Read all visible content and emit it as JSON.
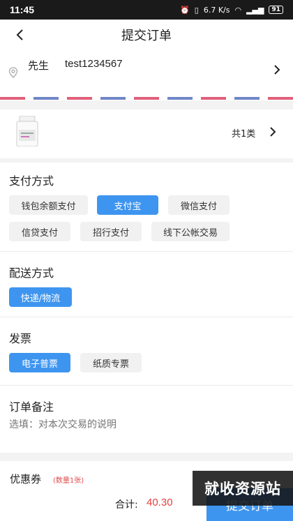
{
  "status": {
    "time": "11:45",
    "net_speed": "6.7 K/s",
    "battery": "91"
  },
  "nav": {
    "title": "提交订单"
  },
  "address": {
    "name": "先生",
    "phone": "test1234567"
  },
  "product": {
    "count_text": "共1类"
  },
  "payment": {
    "title": "支付方式",
    "options": [
      "钱包余额支付",
      "支付宝",
      "微信支付",
      "信贷支付",
      "招行支付",
      "线下公帐交易"
    ],
    "selected": "支付宝"
  },
  "delivery": {
    "title": "配送方式",
    "options": [
      "快递/物流"
    ],
    "selected": "快递/物流"
  },
  "invoice": {
    "title": "发票",
    "options": [
      "电子普票",
      "纸质专票"
    ],
    "selected": "电子普票"
  },
  "remark": {
    "title": "订单备注",
    "placeholder": "选填：对本次交易的说明"
  },
  "coupon": {
    "title": "优惠券",
    "count_text": "(数量1张)"
  },
  "footer": {
    "total_label": "合计:",
    "total_value": "40.30",
    "submit_label": "提交订单"
  },
  "watermark": {
    "text": "就收资源站"
  },
  "colors": {
    "accent": "#3e95f0",
    "price": "#e53f3f",
    "airmail_red": "#e0607a",
    "airmail_blue": "#6f86c8"
  }
}
